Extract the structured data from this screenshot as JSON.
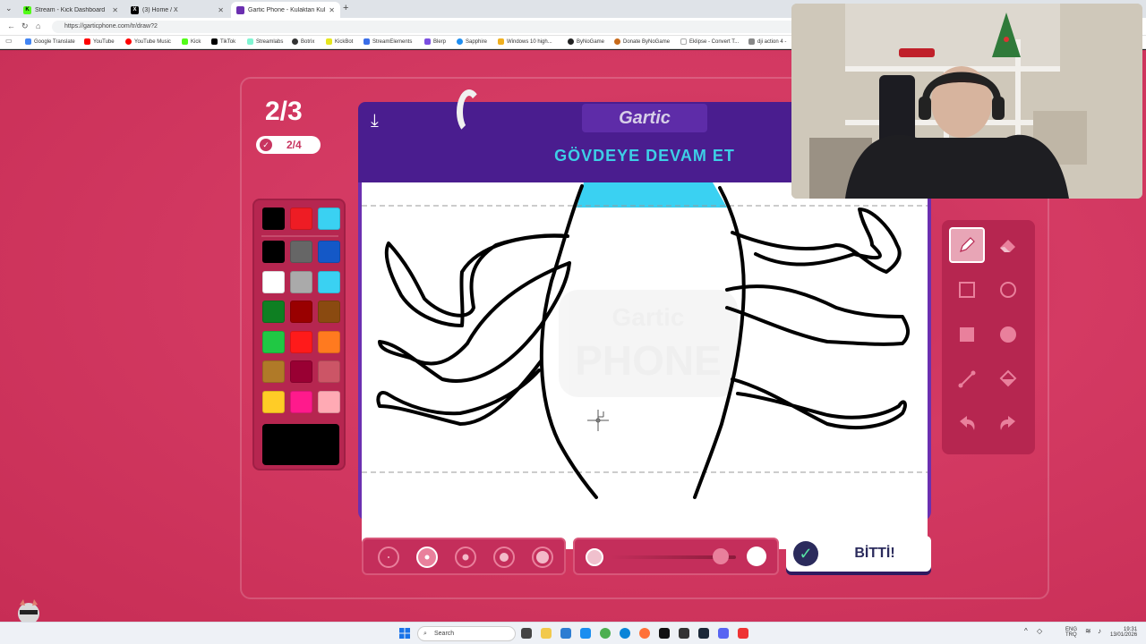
{
  "browser": {
    "tabs": [
      {
        "title": "Stream - Kick Dashboard",
        "favicon": "kick-icon",
        "active": false
      },
      {
        "title": "(3) Home / X",
        "favicon": "x-icon",
        "active": false
      },
      {
        "title": "Gartic Phone - Kulaktan Kulağa",
        "favicon": "gartic-icon",
        "active": true
      }
    ],
    "url": "https://garticphone.com/tr/draw?2",
    "bookmarks": [
      "Google Translate",
      "YouTube",
      "YouTube Music",
      "Kick",
      "TikTok",
      "Streamlabs",
      "Botrix",
      "KickBot",
      "StreamElements",
      "Blerp",
      "Sapphire",
      "Windows 10 high...",
      "ByNoGame",
      "Donate ByNoGame",
      "Eklipse - Convert T...",
      "dji action 4 -"
    ]
  },
  "game": {
    "round": "2/3",
    "progress": "2/4",
    "logo": "Gartic",
    "prompt": "GÖVDEYE DEVAM ET",
    "done_label": "BİTTİ!",
    "watermark_top": "Gartic",
    "watermark_bottom": "PHONE",
    "palette": [
      "#000000",
      "#ee1c24",
      "#3ad1f2",
      "#000000",
      "#666666",
      "#1458c7",
      "#ffffff",
      "#aaaaaa",
      "#3ad1f2",
      "#0e7f22",
      "#990000",
      "#8a4a10",
      "#20c844",
      "#ff1a1a",
      "#ff7a1f",
      "#b07a28",
      "#990033",
      "#cc5566",
      "#ffcc26",
      "#ff1a8c",
      "#ffaab4"
    ],
    "selected_color": "#000000",
    "tools": [
      "pencil-icon",
      "eraser-icon",
      "rectangle-outline-icon",
      "circle-outline-icon",
      "rectangle-fill-icon",
      "circle-fill-icon",
      "line-icon",
      "fill-bucket-icon",
      "undo-icon",
      "redo-icon"
    ],
    "brush_sizes": 5,
    "selected_size_index": 1,
    "opacity": 0.88
  },
  "taskbar": {
    "search_placeholder": "Search",
    "lang": "ENG",
    "lang2": "TRQ",
    "time": "19:31",
    "date": "13/01/2026"
  }
}
